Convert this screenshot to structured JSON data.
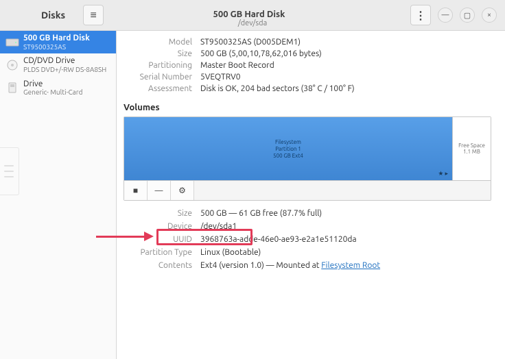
{
  "header": {
    "app_title": "Disks",
    "window_title": "500 GB Hard Disk",
    "window_subtitle": "/dev/sda"
  },
  "sidebar": {
    "items": [
      {
        "title": "500 GB Hard Disk",
        "subtitle": "ST9500325AS"
      },
      {
        "title": "CD/DVD Drive",
        "subtitle": "PLDS DVD+/-RW DS-8A8SH"
      },
      {
        "title": "Drive",
        "subtitle": "Generic- Multi-Card"
      }
    ]
  },
  "disk_info": {
    "model_label": "Model",
    "model_value": "ST9500325AS (D005DEM1)",
    "size_label": "Size",
    "size_value": "500 GB (5,00,10,78,62,016 bytes)",
    "partitioning_label": "Partitioning",
    "partitioning_value": "Master Boot Record",
    "serial_label": "Serial Number",
    "serial_value": "5VEQTRV0",
    "assessment_label": "Assessment",
    "assessment_value": "Disk is OK, 204 bad sectors (38° C / 100° F)"
  },
  "volumes": {
    "section_title": "Volumes",
    "main": {
      "line1": "Filesystem",
      "line2": "Partition 1",
      "line3": "500 GB Ext4",
      "markers": "★ ▸"
    },
    "free": {
      "line1": "Free Space",
      "line2": "1.1 MB"
    }
  },
  "partition_info": {
    "size_label": "Size",
    "size_value": "500 GB — 61 GB free (87.7% full)",
    "device_label": "Device",
    "device_value": "/dev/sda1",
    "uuid_label": "UUID",
    "uuid_value": "3968763a-adde-46e0-ae93-e2a1e51120da",
    "ptype_label": "Partition Type",
    "ptype_value": "Linux (Bootable)",
    "contents_label": "Contents",
    "contents_prefix": "Ext4 (version 1.0) — Mounted at ",
    "contents_link": "Filesystem Root"
  },
  "icons": {
    "hamburger": "≡",
    "kebab": "⋮",
    "min": "—",
    "max": "▢",
    "close": "×",
    "stop": "■",
    "minus": "—",
    "gear": "⚙"
  }
}
